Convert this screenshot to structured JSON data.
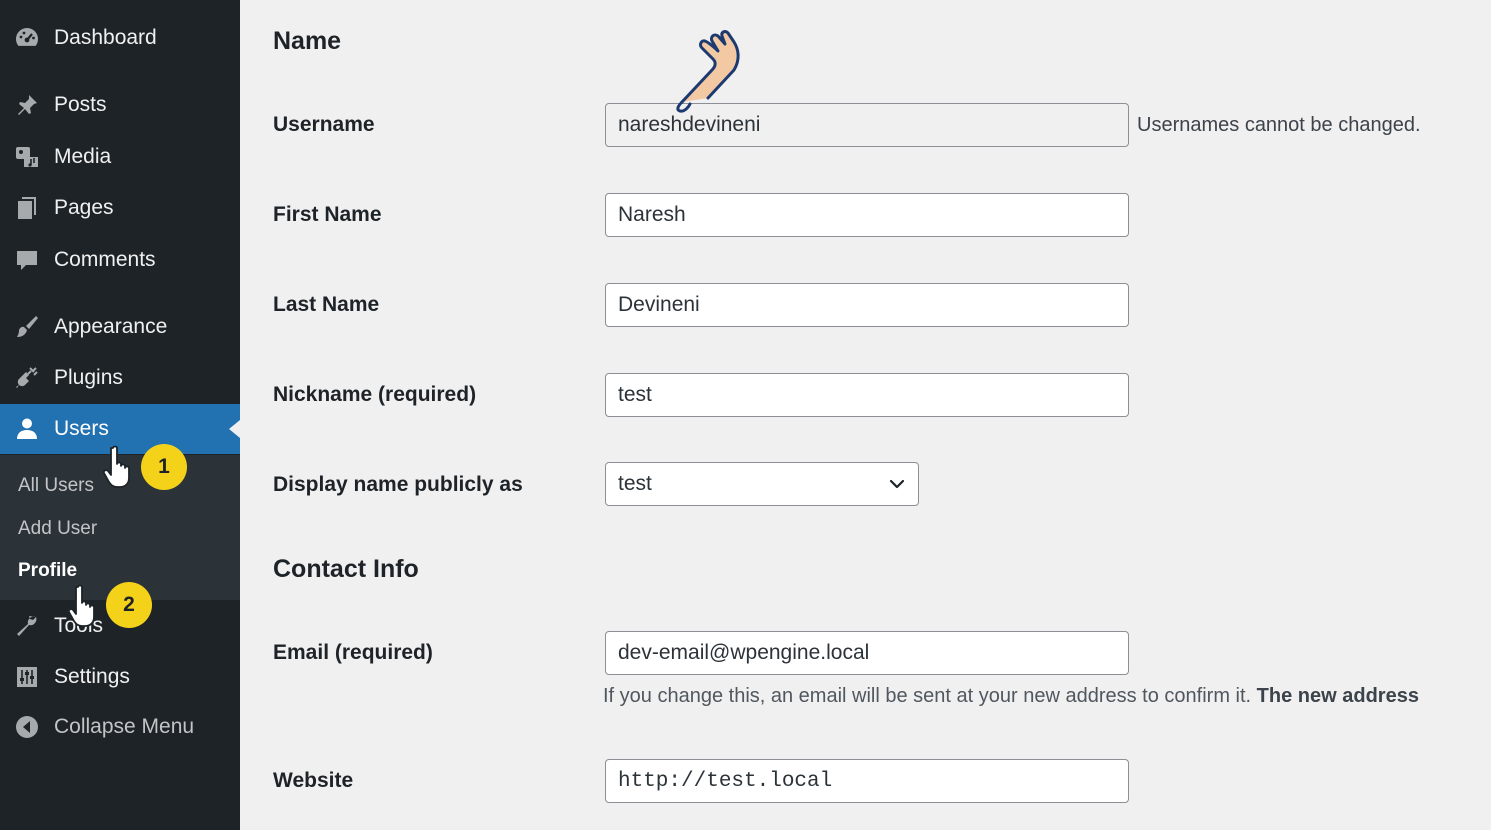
{
  "sidebar": {
    "items": [
      {
        "label": "Dashboard",
        "icon": "dashboard-icon"
      },
      {
        "label": "Posts",
        "icon": "pin-icon"
      },
      {
        "label": "Media",
        "icon": "media-icon"
      },
      {
        "label": "Pages",
        "icon": "pages-icon"
      },
      {
        "label": "Comments",
        "icon": "comment-icon"
      },
      {
        "label": "Appearance",
        "icon": "brush-icon"
      },
      {
        "label": "Plugins",
        "icon": "plug-icon"
      },
      {
        "label": "Users",
        "icon": "user-icon"
      },
      {
        "label": "Tools",
        "icon": "wrench-icon"
      },
      {
        "label": "Settings",
        "icon": "sliders-icon"
      },
      {
        "label": "Collapse Menu",
        "icon": "collapse-icon"
      }
    ],
    "submenu": [
      {
        "label": "All Users"
      },
      {
        "label": "Add User"
      },
      {
        "label": "Profile"
      }
    ],
    "active_item": "Users",
    "current_subitem": "Profile"
  },
  "annotations": {
    "badge_1": "1",
    "badge_2": "2"
  },
  "main": {
    "name_section_title": "Name",
    "contact_section_title": "Contact Info",
    "fields": {
      "username": {
        "label": "Username",
        "value": "nareshdevineni",
        "note": "Usernames cannot be changed."
      },
      "first_name": {
        "label": "First Name",
        "value": "Naresh"
      },
      "last_name": {
        "label": "Last Name",
        "value": "Devineni"
      },
      "nickname": {
        "label": "Nickname (required)",
        "value": "test"
      },
      "display_name": {
        "label": "Display name publicly as",
        "value": "test"
      },
      "email": {
        "label": "Email (required)",
        "value": "dev-email@wpengine.local",
        "note": "If you change this, an email will be sent at your new address to confirm it.",
        "note_bold": "The new address"
      },
      "website": {
        "label": "Website",
        "value": "http://test.local"
      }
    }
  },
  "colors": {
    "sidebar_bg": "#1d2327",
    "submenu_bg": "#2c3338",
    "active_bg": "#2271b1",
    "page_bg": "#f0f0f1",
    "badge": "#f5d21a"
  }
}
